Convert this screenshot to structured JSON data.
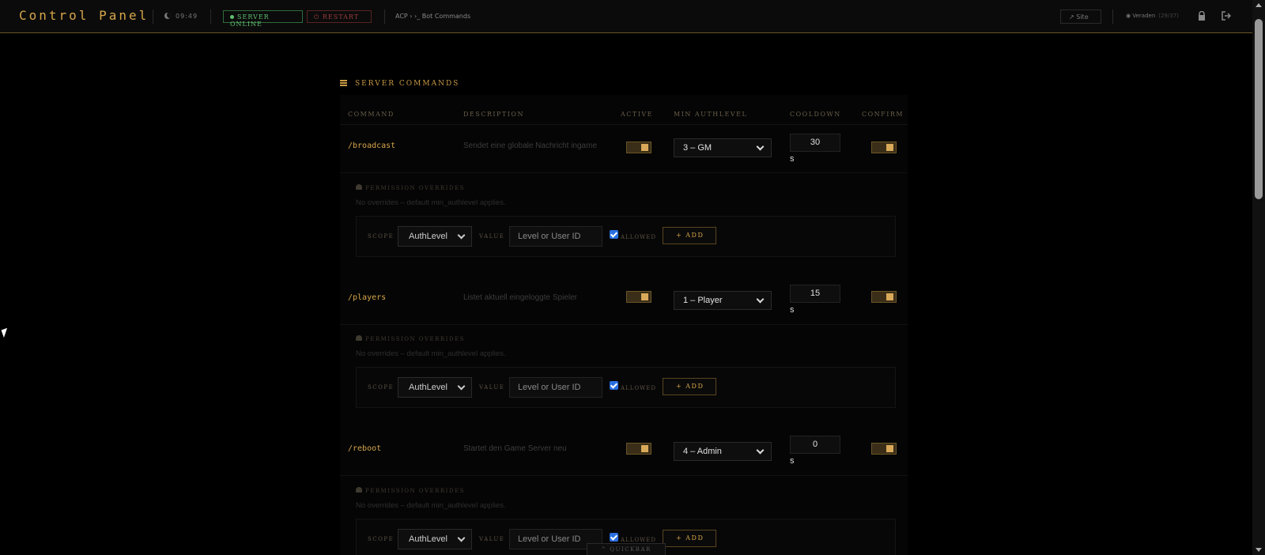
{
  "app": {
    "title": "Control Panel"
  },
  "header": {
    "clock": "09:49",
    "server_status": "SERVER ONLINE",
    "restart_label": "RESTART",
    "breadcrumb": "ACP › ›_ Bot Commands",
    "site_label": "Site",
    "user_name": "Veraden",
    "user_meta": "(29/37)"
  },
  "section": {
    "title": "SERVER COMMANDS"
  },
  "columns": [
    "COMMAND",
    "DESCRIPTION",
    "ACTIVE",
    "MIN AUTHLEVEL",
    "COOLDOWN",
    "CONFIRM"
  ],
  "commands": [
    {
      "name": "/broadcast",
      "description": "Sendet eine globale Nachricht ingame",
      "active": true,
      "min_authlevel": "3 – GM",
      "cooldown": "30",
      "unit": "s",
      "confirm": true
    },
    {
      "name": "/players",
      "description": "Listet aktuell eingeloggte Spieler",
      "active": true,
      "min_authlevel": "1 – Player",
      "cooldown": "15",
      "unit": "s",
      "confirm": true
    },
    {
      "name": "/reboot",
      "description": "Startet den Game Server neu",
      "active": true,
      "min_authlevel": "4 – Admin",
      "cooldown": "0",
      "unit": "s",
      "confirm": true
    }
  ],
  "permissions": {
    "title": "PERMISSION OVERRIDES",
    "note": "No overrides – default min_authlevel applies.",
    "scope_label": "SCOPE",
    "scope_value": "AuthLevel",
    "value_label": "VALUE",
    "value_placeholder": "Level or User ID",
    "allowed_label": "ALLOWED",
    "add_label": "+ ADD"
  },
  "quickbar": {
    "label": "^ QUICKBAR"
  },
  "colors": {
    "accent": "#d6a64a",
    "online": "#5fbf70",
    "restart": "#9c3c3c",
    "checkbox": "#2a6fe0"
  }
}
